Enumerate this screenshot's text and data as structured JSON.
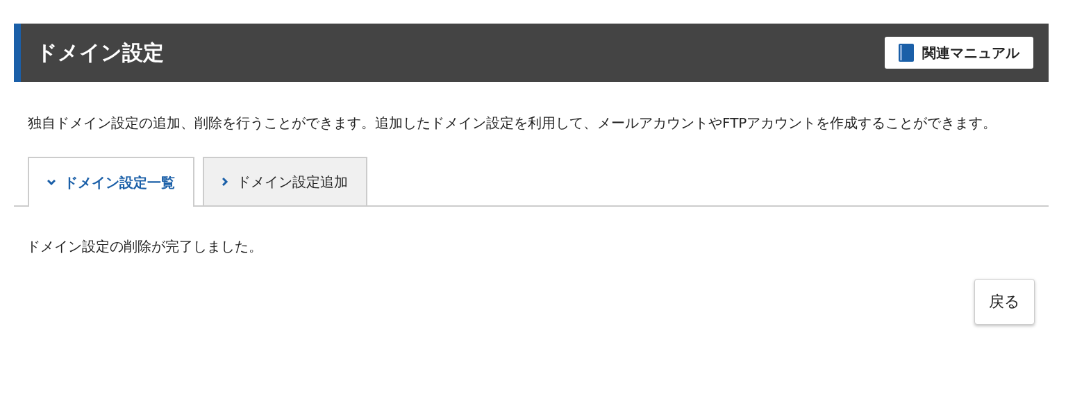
{
  "header": {
    "title": "ドメイン設定",
    "manual_button": "関連マニュアル"
  },
  "description": "独自ドメイン設定の追加、削除を行うことができます。追加したドメイン設定を利用して、メールアカウントやFTPアカウントを作成することができます。",
  "tabs": [
    {
      "label": "ドメイン設定一覧",
      "selected": true
    },
    {
      "label": "ドメイン設定追加",
      "selected": false
    }
  ],
  "message": "ドメイン設定の削除が完了しました。",
  "buttons": [
    "戻る"
  ]
}
